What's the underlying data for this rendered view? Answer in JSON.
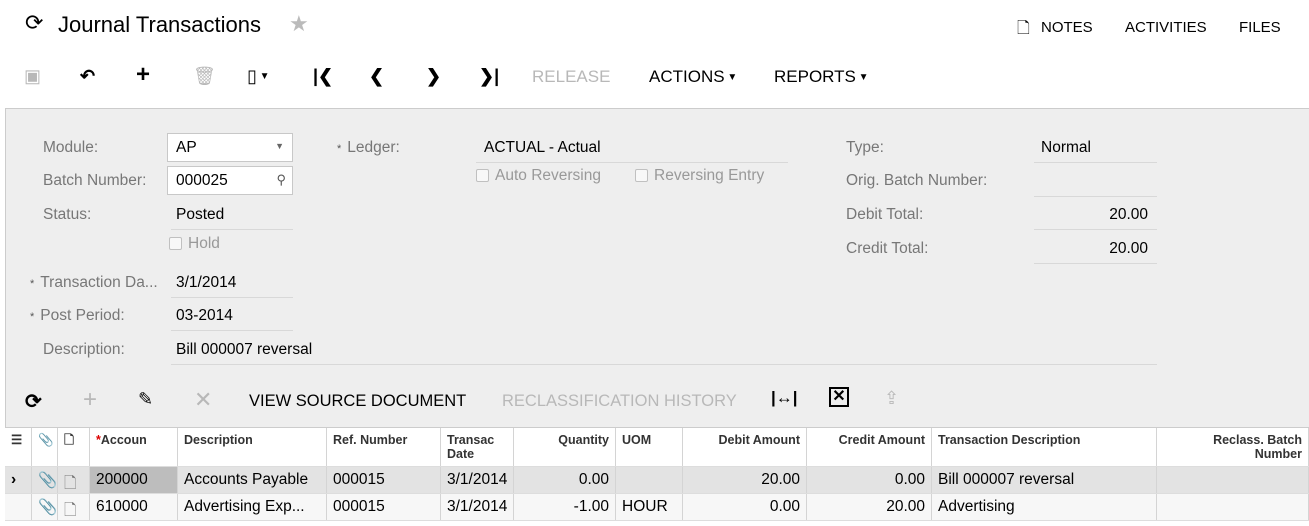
{
  "header": {
    "title": "Journal Transactions",
    "links": [
      "NOTES",
      "ACTIVITIES",
      "FILES"
    ]
  },
  "toolbar": {
    "release": "RELEASE",
    "actions": "ACTIONS",
    "reports": "REPORTS"
  },
  "form": {
    "module_label": "Module:",
    "module_value": "AP",
    "batch_label": "Batch Number:",
    "batch_value": "000025",
    "status_label": "Status:",
    "status_value": "Posted",
    "hold_label": "Hold",
    "trandate_label": "Transaction Da...",
    "trandate_value": "3/1/2014",
    "period_label": "Post Period:",
    "period_value": "03-2014",
    "desc_label": "Description:",
    "desc_value": "Bill 000007 reversal",
    "ledger_label": "Ledger:",
    "ledger_value": "ACTUAL - Actual",
    "auto_rev_label": "Auto Reversing",
    "rev_entry_label": "Reversing Entry",
    "type_label": "Type:",
    "type_value": "Normal",
    "orig_label": "Orig. Batch Number:",
    "orig_value": "",
    "debit_label": "Debit Total:",
    "debit_value": "20.00",
    "credit_label": "Credit Total:",
    "credit_value": "20.00"
  },
  "grid_toolbar": {
    "view_source": "VIEW SOURCE DOCUMENT",
    "reclass_history": "RECLASSIFICATION HISTORY"
  },
  "grid": {
    "headers": {
      "account": "Accoun",
      "description": "Description",
      "ref": "Ref. Number",
      "trandate": "Transac Date",
      "quantity": "Quantity",
      "uom": "UOM",
      "debit": "Debit Amount",
      "credit": "Credit Amount",
      "trandesc": "Transaction Description",
      "reclass": "Reclass. Batch Number"
    },
    "rows": [
      {
        "account": "200000",
        "description": "Accounts Payable",
        "ref": "000015",
        "trandate": "3/1/2014",
        "quantity": "0.00",
        "uom": "",
        "debit": "20.00",
        "credit": "0.00",
        "trandesc": "Bill 000007 reversal",
        "reclass": ""
      },
      {
        "account": "610000",
        "description": "Advertising Exp...",
        "ref": "000015",
        "trandate": "3/1/2014",
        "quantity": "-1.00",
        "uom": "HOUR",
        "debit": "0.00",
        "credit": "20.00",
        "trandesc": "Advertising",
        "reclass": ""
      }
    ]
  }
}
